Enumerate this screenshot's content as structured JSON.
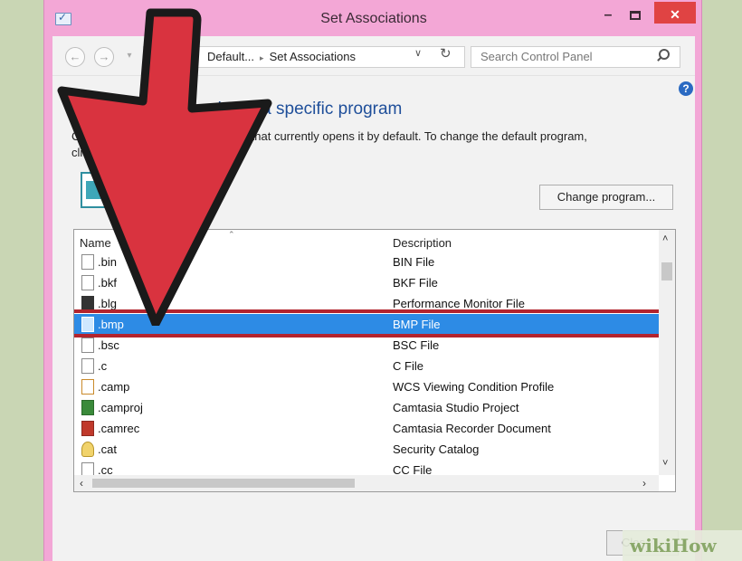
{
  "window": {
    "title": "Set Associations",
    "minimize_glyph": "–",
    "close_glyph": "✕"
  },
  "nav": {
    "back_glyph": "←",
    "forward_glyph": "→",
    "up_glyph": "▾",
    "breadcrumb": [
      "Default...",
      "Set Associations"
    ],
    "breadcrumb_sep": "▸",
    "dropdown_glyph": "∨",
    "refresh_glyph": "↻",
    "search_placeholder": "Search Control Panel"
  },
  "help": {
    "glyph": "?"
  },
  "main": {
    "heading_visible": "te         ype o    ocol with a specific program",
    "instruction_visible_line1": "C                                      program that currently opens it by default. To change the default program,",
    "instruction_visible_line2": "cli",
    "current_program_visible": "ion",
    "change_program_label": "Change program..."
  },
  "list": {
    "columns": {
      "name": "Name",
      "description": "Description",
      "sort_glyph": "⌃"
    },
    "rows": [
      {
        "ext": ".bin",
        "desc": "BIN File",
        "icon": "generic-file-icon",
        "selected": false
      },
      {
        "ext": ".bkf",
        "desc": "BKF File",
        "icon": "generic-file-icon",
        "selected": false
      },
      {
        "ext": ".blg",
        "desc": "Performance Monitor File",
        "icon": "performance-monitor-icon",
        "selected": false
      },
      {
        "ext": ".bmp",
        "desc": "BMP File",
        "icon": "image-file-icon",
        "selected": true
      },
      {
        "ext": ".bsc",
        "desc": "BSC File",
        "icon": "generic-file-icon",
        "selected": false
      },
      {
        "ext": ".c",
        "desc": "C File",
        "icon": "generic-file-icon",
        "selected": false
      },
      {
        "ext": ".camp",
        "desc": "WCS Viewing Condition Profile",
        "icon": "color-profile-icon",
        "selected": false
      },
      {
        "ext": ".camproj",
        "desc": "Camtasia Studio Project",
        "icon": "camtasia-project-icon",
        "selected": false
      },
      {
        "ext": ".camrec",
        "desc": "Camtasia Recorder Document",
        "icon": "camtasia-recorder-icon",
        "selected": false
      },
      {
        "ext": ".cat",
        "desc": "Security Catalog",
        "icon": "security-catalog-icon",
        "selected": false
      },
      {
        "ext": ".cc",
        "desc": "CC File",
        "icon": "generic-file-icon",
        "selected": false
      }
    ],
    "scroll_up": "˄",
    "scroll_down": "˅",
    "scroll_left": "‹",
    "scroll_right": "›"
  },
  "footer": {
    "close_label_visible": "Clos"
  },
  "watermark": "wikiHow",
  "colors": {
    "title_bar": "#f3a7d6",
    "selection": "#2d8be5",
    "highlight_outline": "#b3242e",
    "arrow": "#d9333f",
    "heading": "#1f4f9a"
  }
}
